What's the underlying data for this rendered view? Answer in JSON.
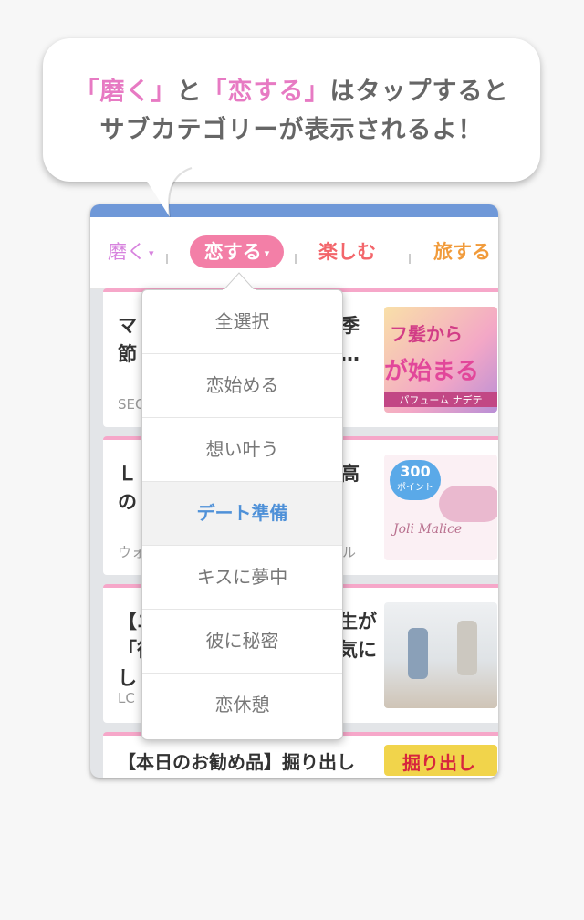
{
  "bubble": {
    "line1_q1": "「磨く」",
    "line1_mid": "と",
    "line1_q2": "「恋する」",
    "line1_end": "はタップすると",
    "line2": "サブカテゴリーが表示されるよ！"
  },
  "tabs": [
    {
      "label": "磨く",
      "arrow": "▾"
    },
    {
      "label": "恋する",
      "arrow": "▾"
    },
    {
      "label": "楽しむ"
    },
    {
      "label": "旅する"
    }
  ],
  "articles": [
    {
      "title": "マ\n節",
      "title_right": "季\n…",
      "source": "SEC",
      "thumb_text1": "フ髪から",
      "thumb_text2": "が始まる",
      "thumb_text3": "パフューム ナデテ"
    },
    {
      "title": "Ｌ\nの",
      "title_right": "高",
      "source": "ウォ",
      "source_right": "ル",
      "thumb_text1": "300",
      "thumb_text2": "ポイント",
      "thumb_text3": "Joli Malice"
    },
    {
      "title": "【ニ\n「彼\nし",
      "title_right": "生が\n気に",
      "source": "LC"
    },
    {
      "title": "【本日のお勧め品】掘り出し",
      "thumb_text1": "掘り出し"
    }
  ],
  "dropdown": {
    "items": [
      "全選択",
      "恋始める",
      "想い叶う",
      "デート準備",
      "キスに夢中",
      "彼に秘密",
      "恋休憩"
    ],
    "selected": "デート準備"
  },
  "colors": {
    "accent_pink": "#f37fa7",
    "highlight_text": "#e77ac3",
    "selected_blue": "#4f91d8",
    "topbar_blue": "#6f98d8"
  }
}
